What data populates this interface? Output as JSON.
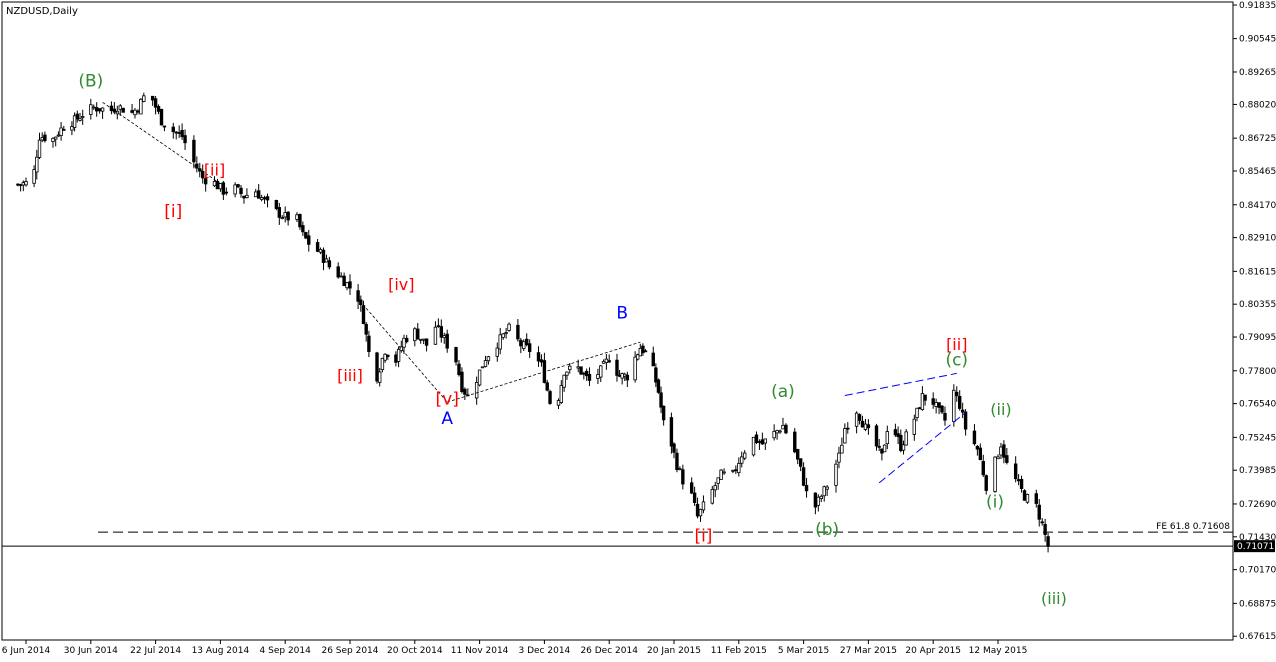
{
  "window": {
    "title": "NZDUSD,Daily"
  },
  "colors": {
    "background": "#ffffff",
    "candle": "#000000",
    "frame": "#000000",
    "label_red": "#ff0000",
    "label_green": "#2e8b2e",
    "label_blue": "#0000ff",
    "trendline_blue": "#0000ff",
    "dotted_line": "#000000"
  },
  "chart_data": {
    "type": "candlestick",
    "symbol": "NZDUSD",
    "timeframe": "Daily",
    "title": "NZDUSD,Daily",
    "ylim": [
      0.6747,
      0.9195
    ],
    "y_ticks": [
      "0.91835",
      "0.90545",
      "0.89265",
      "0.88020",
      "0.86725",
      "0.85465",
      "0.84170",
      "0.82910",
      "0.81615",
      "0.80355",
      "0.79095",
      "0.77800",
      "0.76540",
      "0.75245",
      "0.73985",
      "0.72690",
      "0.71430",
      "0.70170",
      "0.68875",
      "0.67615"
    ],
    "x_ticks": [
      {
        "label": "6 Jun 2014",
        "date": "2014-06-06"
      },
      {
        "label": "30 Jun 2014",
        "date": "2014-06-30"
      },
      {
        "label": "22 Jul 2014",
        "date": "2014-07-22"
      },
      {
        "label": "13 Aug 2014",
        "date": "2014-08-13"
      },
      {
        "label": "4 Sep 2014",
        "date": "2014-09-04"
      },
      {
        "label": "26 Sep 2014",
        "date": "2014-09-26"
      },
      {
        "label": "20 Oct 2014",
        "date": "2014-10-20"
      },
      {
        "label": "11 Nov 2014",
        "date": "2014-11-11"
      },
      {
        "label": "3 Dec 2014",
        "date": "2014-12-03"
      },
      {
        "label": "26 Dec 2014",
        "date": "2014-12-26"
      },
      {
        "label": "20 Jan 2015",
        "date": "2015-01-20"
      },
      {
        "label": "11 Feb 2015",
        "date": "2015-02-11"
      },
      {
        "label": "5 Mar 2015",
        "date": "2015-03-05"
      },
      {
        "label": "27 Mar 2015",
        "date": "2015-03-27"
      },
      {
        "label": "20 Apr 2015",
        "date": "2015-04-20"
      },
      {
        "label": "12 May 2015",
        "date": "2015-05-12"
      }
    ],
    "close_path": [
      {
        "date": "2014-06-03",
        "close": 0.8495
      },
      {
        "date": "2014-06-06",
        "close": 0.85
      },
      {
        "date": "2014-06-09",
        "close": 0.8545
      },
      {
        "date": "2014-06-11",
        "close": 0.868
      },
      {
        "date": "2014-06-16",
        "close": 0.867
      },
      {
        "date": "2014-06-20",
        "close": 0.872
      },
      {
        "date": "2014-06-24",
        "close": 0.874
      },
      {
        "date": "2014-06-27",
        "close": 0.8765
      },
      {
        "date": "2014-07-01",
        "close": 0.879
      },
      {
        "date": "2014-07-07",
        "close": 0.878
      },
      {
        "date": "2014-07-09",
        "close": 0.8795
      },
      {
        "date": "2014-07-14",
        "close": 0.877
      },
      {
        "date": "2014-07-16",
        "close": 0.879
      },
      {
        "date": "2014-07-18",
        "close": 0.883
      },
      {
        "date": "2014-07-21",
        "close": 0.882
      },
      {
        "date": "2014-07-24",
        "close": 0.874
      },
      {
        "date": "2014-07-28",
        "close": 0.87
      },
      {
        "date": "2014-07-31",
        "close": 0.868
      },
      {
        "date": "2014-08-04",
        "close": 0.858
      },
      {
        "date": "2014-08-07",
        "close": 0.852
      },
      {
        "date": "2014-08-11",
        "close": 0.85
      },
      {
        "date": "2014-08-14",
        "close": 0.847
      },
      {
        "date": "2014-08-18",
        "close": 0.848
      },
      {
        "date": "2014-08-21",
        "close": 0.845
      },
      {
        "date": "2014-08-25",
        "close": 0.847
      },
      {
        "date": "2014-08-28",
        "close": 0.843
      },
      {
        "date": "2014-09-01",
        "close": 0.839
      },
      {
        "date": "2014-09-04",
        "close": 0.837
      },
      {
        "date": "2014-09-08",
        "close": 0.836
      },
      {
        "date": "2014-09-10",
        "close": 0.83
      },
      {
        "date": "2014-09-12",
        "close": 0.827
      },
      {
        "date": "2014-09-16",
        "close": 0.823
      },
      {
        "date": "2014-09-19",
        "close": 0.818
      },
      {
        "date": "2014-09-23",
        "close": 0.814
      },
      {
        "date": "2014-09-26",
        "close": 0.81
      },
      {
        "date": "2014-09-29",
        "close": 0.806
      },
      {
        "date": "2014-10-01",
        "close": 0.798
      },
      {
        "date": "2014-10-03",
        "close": 0.785
      },
      {
        "date": "2014-10-06",
        "close": 0.776
      },
      {
        "date": "2014-10-09",
        "close": 0.786
      },
      {
        "date": "2014-10-13",
        "close": 0.782
      },
      {
        "date": "2014-10-16",
        "close": 0.79
      },
      {
        "date": "2014-10-20",
        "close": 0.793
      },
      {
        "date": "2014-10-24",
        "close": 0.788
      },
      {
        "date": "2014-10-27",
        "close": 0.795
      },
      {
        "date": "2014-10-30",
        "close": 0.79
      },
      {
        "date": "2014-11-03",
        "close": 0.782
      },
      {
        "date": "2014-11-05",
        "close": 0.772
      },
      {
        "date": "2014-11-07",
        "close": 0.768
      },
      {
        "date": "2014-11-10",
        "close": 0.775
      },
      {
        "date": "2014-11-13",
        "close": 0.783
      },
      {
        "date": "2014-11-18",
        "close": 0.79
      },
      {
        "date": "2014-11-21",
        "close": 0.794
      },
      {
        "date": "2014-11-25",
        "close": 0.788
      },
      {
        "date": "2014-11-28",
        "close": 0.786
      },
      {
        "date": "2014-12-02",
        "close": 0.78
      },
      {
        "date": "2014-12-05",
        "close": 0.766
      },
      {
        "date": "2014-12-08",
        "close": 0.768
      },
      {
        "date": "2014-12-10",
        "close": 0.778
      },
      {
        "date": "2014-12-15",
        "close": 0.779
      },
      {
        "date": "2014-12-19",
        "close": 0.774
      },
      {
        "date": "2014-12-23",
        "close": 0.778
      },
      {
        "date": "2014-12-26",
        "close": 0.783
      },
      {
        "date": "2014-12-30",
        "close": 0.776
      },
      {
        "date": "2015-01-02",
        "close": 0.776
      },
      {
        "date": "2015-01-05",
        "close": 0.783
      },
      {
        "date": "2015-01-07",
        "close": 0.787
      },
      {
        "date": "2015-01-09",
        "close": 0.785
      },
      {
        "date": "2015-01-12",
        "close": 0.778
      },
      {
        "date": "2015-01-14",
        "close": 0.77
      },
      {
        "date": "2015-01-16",
        "close": 0.758
      },
      {
        "date": "2015-01-19",
        "close": 0.75
      },
      {
        "date": "2015-01-21",
        "close": 0.742
      },
      {
        "date": "2015-01-23",
        "close": 0.736
      },
      {
        "date": "2015-01-26",
        "close": 0.73
      },
      {
        "date": "2015-01-28",
        "close": 0.722
      },
      {
        "date": "2015-01-30",
        "close": 0.726
      },
      {
        "date": "2015-02-02",
        "close": 0.732
      },
      {
        "date": "2015-02-05",
        "close": 0.738
      },
      {
        "date": "2015-02-09",
        "close": 0.738
      },
      {
        "date": "2015-02-12",
        "close": 0.746
      },
      {
        "date": "2015-02-16",
        "close": 0.752
      },
      {
        "date": "2015-02-19",
        "close": 0.75
      },
      {
        "date": "2015-02-23",
        "close": 0.754
      },
      {
        "date": "2015-02-26",
        "close": 0.757
      },
      {
        "date": "2015-03-02",
        "close": 0.747
      },
      {
        "date": "2015-03-04",
        "close": 0.74
      },
      {
        "date": "2015-03-06",
        "close": 0.731
      },
      {
        "date": "2015-03-09",
        "close": 0.726
      },
      {
        "date": "2015-03-11",
        "close": 0.73
      },
      {
        "date": "2015-03-13",
        "close": 0.734
      },
      {
        "date": "2015-03-17",
        "close": 0.745
      },
      {
        "date": "2015-03-19",
        "close": 0.756
      },
      {
        "date": "2015-03-23",
        "close": 0.763
      },
      {
        "date": "2015-03-26",
        "close": 0.756
      },
      {
        "date": "2015-03-30",
        "close": 0.749
      },
      {
        "date": "2015-04-01",
        "close": 0.745
      },
      {
        "date": "2015-04-03",
        "close": 0.756
      },
      {
        "date": "2015-04-06",
        "close": 0.754
      },
      {
        "date": "2015-04-08",
        "close": 0.749
      },
      {
        "date": "2015-04-10",
        "close": 0.753
      },
      {
        "date": "2015-04-14",
        "close": 0.762
      },
      {
        "date": "2015-04-16",
        "close": 0.768
      },
      {
        "date": "2015-04-20",
        "close": 0.766
      },
      {
        "date": "2015-04-22",
        "close": 0.762
      },
      {
        "date": "2015-04-24",
        "close": 0.759
      },
      {
        "date": "2015-04-27",
        "close": 0.77
      },
      {
        "date": "2015-04-29",
        "close": 0.765
      },
      {
        "date": "2015-05-01",
        "close": 0.756
      },
      {
        "date": "2015-05-05",
        "close": 0.748
      },
      {
        "date": "2015-05-07",
        "close": 0.739
      },
      {
        "date": "2015-05-08",
        "close": 0.734
      },
      {
        "date": "2015-05-11",
        "close": 0.743
      },
      {
        "date": "2015-05-13",
        "close": 0.75
      },
      {
        "date": "2015-05-15",
        "close": 0.742
      },
      {
        "date": "2015-05-19",
        "close": 0.734
      },
      {
        "date": "2015-05-21",
        "close": 0.73
      },
      {
        "date": "2015-05-25",
        "close": 0.726
      },
      {
        "date": "2015-05-27",
        "close": 0.719
      },
      {
        "date": "2015-05-29",
        "close": 0.7107
      }
    ],
    "wave_labels": [
      {
        "text": "(B)",
        "date": "2014-06-30",
        "price": 0.887,
        "color": "green"
      },
      {
        "text": "[i]",
        "date": "2014-07-28",
        "price": 0.837,
        "color": "red"
      },
      {
        "text": "[ii]",
        "date": "2014-08-11",
        "price": 0.853,
        "color": "red"
      },
      {
        "text": "[iii]",
        "date": "2014-09-26",
        "price": 0.774,
        "color": "red"
      },
      {
        "text": "[iv]",
        "date": "2014-10-15",
        "price": 0.809,
        "color": "red"
      },
      {
        "text": "[v]",
        "date": "2014-10-31",
        "price": 0.765,
        "color": "red"
      },
      {
        "text": "A",
        "date": "2014-10-31",
        "price": 0.7575,
        "color": "blue"
      },
      {
        "text": "B",
        "date": "2014-12-31",
        "price": 0.798,
        "color": "blue"
      },
      {
        "text": "[i]",
        "date": "2015-01-30",
        "price": 0.7125,
        "color": "red"
      },
      {
        "text": "(a)",
        "date": "2015-02-26",
        "price": 0.768,
        "color": "green"
      },
      {
        "text": "(b)",
        "date": "2015-03-13",
        "price": 0.715,
        "color": "green"
      },
      {
        "text": "[ii]",
        "date": "2015-04-28",
        "price": 0.786,
        "color": "red"
      },
      {
        "text": "(c)",
        "date": "2015-04-28",
        "price": 0.78,
        "color": "green"
      },
      {
        "text": "(ii)",
        "date": "2015-05-13",
        "price": 0.761,
        "color": "green"
      },
      {
        "text": "(i)",
        "date": "2015-05-11",
        "price": 0.7255,
        "color": "green"
      },
      {
        "text": "(iii)",
        "date": "2015-05-31",
        "price": 0.6885,
        "color": "green"
      }
    ],
    "dotted_lines": [
      {
        "from": {
          "date": "2014-07-04",
          "price": 0.881
        },
        "to": {
          "date": "2014-08-14",
          "price": 0.849
        }
      },
      {
        "from": {
          "date": "2014-10-02",
          "price": 0.802
        },
        "to": {
          "date": "2014-10-31",
          "price": 0.766
        }
      },
      {
        "from": {
          "date": "2014-10-31",
          "price": 0.766
        },
        "to": {
          "date": "2015-01-07",
          "price": 0.789
        }
      }
    ],
    "trendlines": [
      {
        "from": {
          "date": "2015-03-19",
          "price": 0.7685
        },
        "to": {
          "date": "2015-04-28",
          "price": 0.777
        }
      },
      {
        "from": {
          "date": "2015-03-31",
          "price": 0.735
        },
        "to": {
          "date": "2015-05-01",
          "price": 0.762
        }
      }
    ],
    "level_lines": [
      {
        "name": "FE 61.8",
        "price": 0.71608,
        "price_label": "0.71608",
        "style": "dashed"
      }
    ],
    "current_price": {
      "price": 0.71071,
      "label": "0.71071"
    }
  }
}
